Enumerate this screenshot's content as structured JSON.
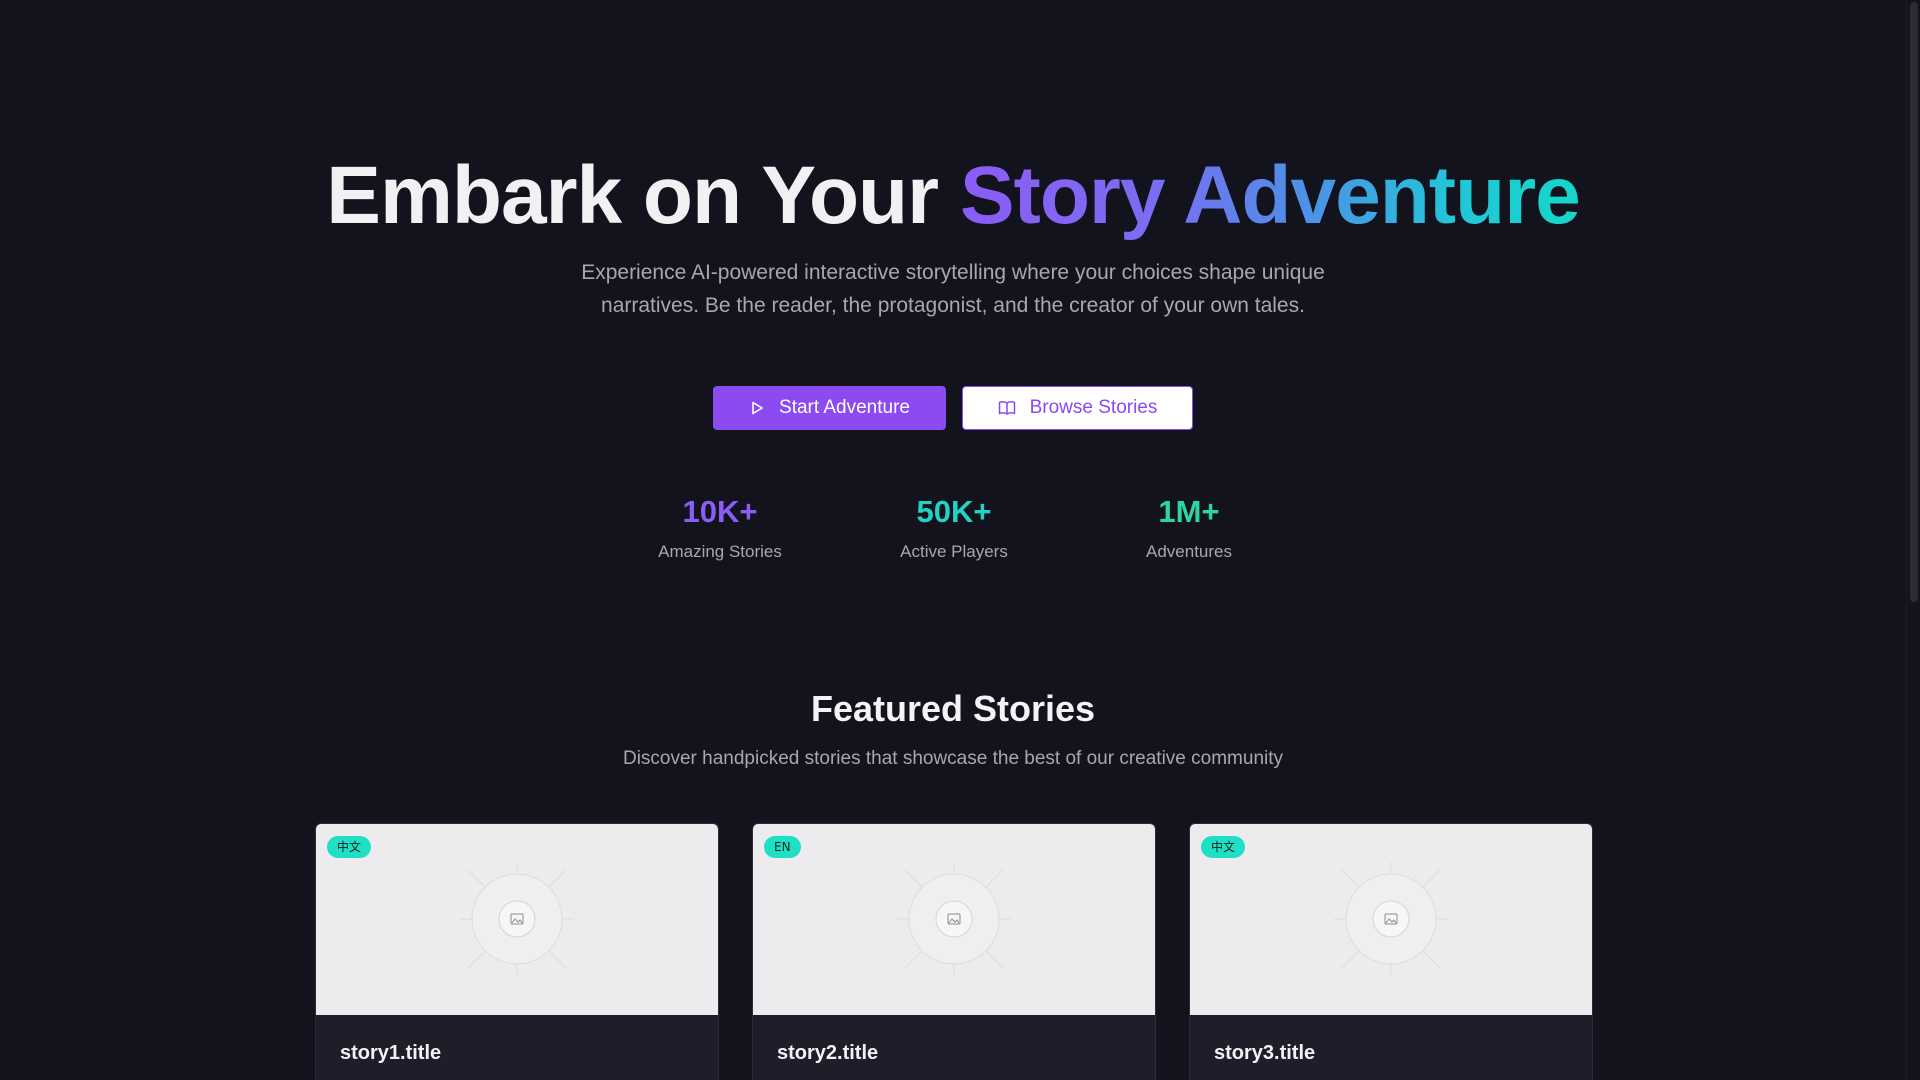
{
  "hero": {
    "title_plain": "Embark on Your ",
    "title_highlight": "Story Adventure",
    "subtitle": "Experience AI-powered interactive storytelling where your choices shape unique narratives. Be the reader, the protagonist, and the creator of your own tales.",
    "primary_button": "Start Adventure",
    "secondary_button": "Browse Stories",
    "primary_icon": "play-icon",
    "secondary_icon": "book-open-icon"
  },
  "stats": [
    {
      "value": "10K+",
      "label": "Amazing Stories",
      "color": "#8b5cf6"
    },
    {
      "value": "50K+",
      "label": "Active Players",
      "color": "#22d3c5"
    },
    {
      "value": "1M+",
      "label": "Adventures",
      "color": "#2dd4a4"
    }
  ],
  "featured": {
    "title": "Featured Stories",
    "subtitle": "Discover handpicked stories that showcase the best of our creative community"
  },
  "cards": [
    {
      "badge": "中文",
      "title": "story1.title",
      "image_icon": "image-placeholder-icon"
    },
    {
      "badge": "EN",
      "title": "story2.title",
      "image_icon": "image-placeholder-icon"
    },
    {
      "badge": "中文",
      "title": "story3.title",
      "image_icon": "image-placeholder-icon"
    }
  ],
  "colors": {
    "background": "#13131d",
    "accent": "#8b4af2",
    "badge": "#1fe0c4"
  }
}
